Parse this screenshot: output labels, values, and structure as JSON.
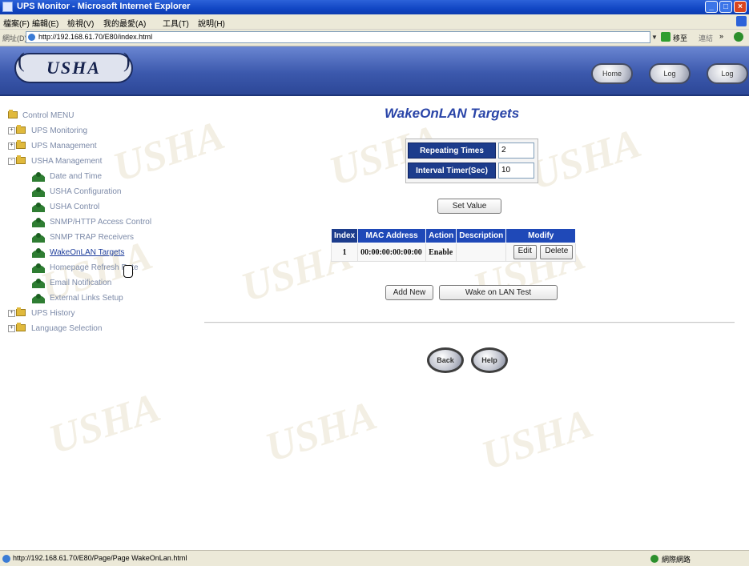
{
  "window": {
    "title": "UPS Monitor - Microsoft Internet Explorer",
    "min_label": "_",
    "max_label": "□",
    "close_label": "×"
  },
  "menubar": {
    "items": [
      "檔案(F)",
      "編輯(E)",
      "檢視(V)",
      "我的最愛(A)",
      "工具(T)",
      "說明(H)"
    ]
  },
  "address": {
    "label": "網址(D)",
    "url": "http://192.168.61.70/E80/index.html",
    "go_label": "移至",
    "links_label": "連結",
    "more": "»"
  },
  "banner": {
    "logo_text": "USHA",
    "buttons": [
      "Home",
      "Log",
      "Log"
    ]
  },
  "tree": {
    "root": "Control MENU",
    "items": [
      {
        "label": "UPS Monitoring",
        "type": "folder",
        "expander": "+"
      },
      {
        "label": "UPS Management",
        "type": "folder",
        "expander": "+"
      },
      {
        "label": "USHA Management",
        "type": "folder",
        "expander": "-"
      },
      {
        "label": "Date and Time",
        "type": "page"
      },
      {
        "label": "USHA Configuration",
        "type": "page"
      },
      {
        "label": "USHA Control",
        "type": "page"
      },
      {
        "label": "SNMP/HTTP Access Control",
        "type": "page"
      },
      {
        "label": "SNMP TRAP Receivers",
        "type": "page"
      },
      {
        "label": "WakeOnLAN Targets",
        "type": "page",
        "active": true
      },
      {
        "label": "Homepage Refresh Rate",
        "type": "page"
      },
      {
        "label": "Email Notification",
        "type": "page"
      },
      {
        "label": "External Links Setup",
        "type": "page"
      },
      {
        "label": "UPS History",
        "type": "folder",
        "expander": "+"
      },
      {
        "label": "Language Selection",
        "type": "folder",
        "expander": "+"
      }
    ]
  },
  "main": {
    "title": "WakeOnLAN Targets",
    "settings": [
      {
        "label": "Repeating Times",
        "value": "2"
      },
      {
        "label": "Interval Timer(Sec)",
        "value": "10"
      }
    ],
    "set_value_label": "Set Value",
    "table": {
      "headers": [
        "Index",
        "MAC Address",
        "Action",
        "Description",
        "Modify"
      ],
      "rows": [
        {
          "index": "1",
          "mac": "00:00:00:00:00:00",
          "action": "Enable",
          "description": "",
          "edit_label": "Edit",
          "delete_label": "Delete"
        }
      ]
    },
    "add_new_label": "Add New",
    "wake_test_label": "Wake on LAN Test",
    "back_label": "Back",
    "help_label": "Help"
  },
  "watermark_text": "USHA",
  "statusbar": {
    "text": "http://192.168.61.70/E80/Page/Page WakeOnLan.html",
    "zone": "網際網路"
  }
}
